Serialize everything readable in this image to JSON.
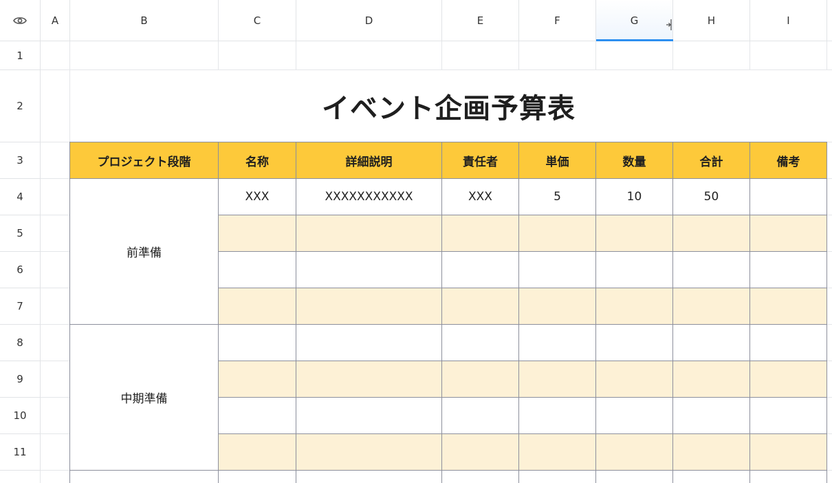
{
  "sheet": {
    "corner_icon": "eye-icon",
    "resize_icon": "column-resize-icon",
    "selected_column": "G",
    "columns": [
      "A",
      "B",
      "C",
      "D",
      "E",
      "F",
      "G",
      "H",
      "I"
    ],
    "rows": [
      "1",
      "2",
      "3",
      "4",
      "5",
      "6",
      "7",
      "8",
      "9",
      "10",
      "11"
    ]
  },
  "table": {
    "title": "イベント企画予算表",
    "headers": [
      "プロジェクト段階",
      "名称",
      "詳細説明",
      "責任者",
      "単価",
      "数量",
      "合計",
      "備考"
    ],
    "phases": [
      {
        "label": "前準備",
        "rows": [
          [
            "XXX",
            "XXXXXXXXXXX",
            "XXX",
            "5",
            "10",
            "50",
            ""
          ],
          [
            "",
            "",
            "",
            "",
            "",
            "",
            ""
          ],
          [
            "",
            "",
            "",
            "",
            "",
            "",
            ""
          ],
          [
            "",
            "",
            "",
            "",
            "",
            "",
            ""
          ]
        ]
      },
      {
        "label": "中期準備",
        "rows": [
          [
            "",
            "",
            "",
            "",
            "",
            "",
            ""
          ],
          [
            "",
            "",
            "",
            "",
            "",
            "",
            ""
          ],
          [
            "",
            "",
            "",
            "",
            "",
            "",
            ""
          ],
          [
            "",
            "",
            "",
            "",
            "",
            "",
            ""
          ]
        ]
      }
    ]
  },
  "colors": {
    "header_fill": "#fdc93a",
    "band_fill": "#fdf1d6",
    "table_border": "#8c8f9c",
    "selection_accent": "#2d8ff0"
  }
}
